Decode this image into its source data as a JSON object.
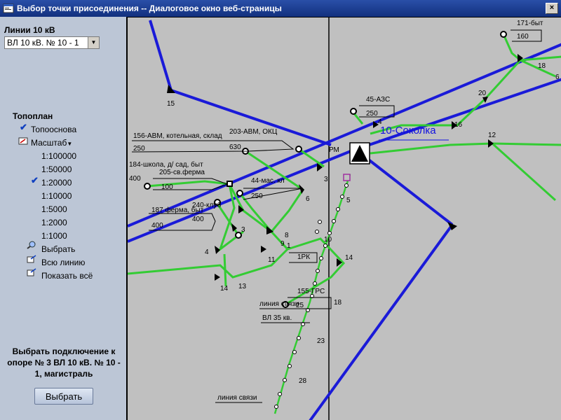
{
  "window": {
    "title": "Выбор точки присоединения -- Диалоговое окно веб-страницы",
    "close_glyph": "×"
  },
  "sidebar": {
    "lines_label": "Линии 10 кВ",
    "line_select": {
      "value": "ВЛ 10 кВ. № 10 - 1"
    },
    "topoplan_label": "Топоплан",
    "topobase": "Топооснова",
    "scale_label": "Масштаб",
    "scales": [
      "1:100000",
      "1:50000",
      "1:20000",
      "1:10000",
      "1:5000",
      "1:2000",
      "1:1000"
    ],
    "selected_scale": "1:20000",
    "actions": {
      "select": "Выбрать",
      "whole_line": "Всю линию",
      "show_all": "Показать всё"
    },
    "info_text": "Выбрать подключение к опоре № 3 ВЛ 10 кВ. № 10 - 1, магистраль",
    "select_button": "Выбрать"
  },
  "map": {
    "substation_label": "10-Соколка",
    "labels": {
      "l171": "171-быт",
      "l160": "160",
      "l18a": "18",
      "l6r": "6",
      "l20": "20",
      "l16": "16",
      "l12": "12",
      "l45": "45-АЗС",
      "l250a": "250",
      "l4": "4",
      "l15": "15",
      "l156": "156-АВМ, котельная, склад",
      "l250b": "250",
      "l203": "203-АВМ, ОКЦ",
      "l630": "630",
      "lPM": "РМ",
      "l184": "184-школа, д/ сад, быт",
      "l205": "205-св.ферма",
      "l400a": "400",
      "l100": "100",
      "l3a": "3",
      "l44": "44-мас. кл",
      "l250c": "250",
      "l240": "240-клуб",
      "l187": "187 ферма, быт",
      "l400b": "400",
      "l400c": "400",
      "l5": "5",
      "l6": "6",
      "l3b": "3",
      "l8": "8",
      "l4b": "4",
      "l9": "9",
      "l1": "1",
      "l10": "10",
      "l1PK": "1РК",
      "l11": "11",
      "l14a": "14",
      "l14b": "14",
      "l13": "13",
      "l155": "155-ГРС",
      "l25": "25",
      "l18b": "18",
      "lcomm1": "линия связи",
      "lvl35": "ВЛ 35 кв.",
      "l23": "23",
      "l28": "28",
      "lcomm2": "линия связи"
    }
  },
  "colors": {
    "blue_line": "#1a1ad8",
    "green_line": "#33cc33",
    "titlebar": "#12307e"
  }
}
